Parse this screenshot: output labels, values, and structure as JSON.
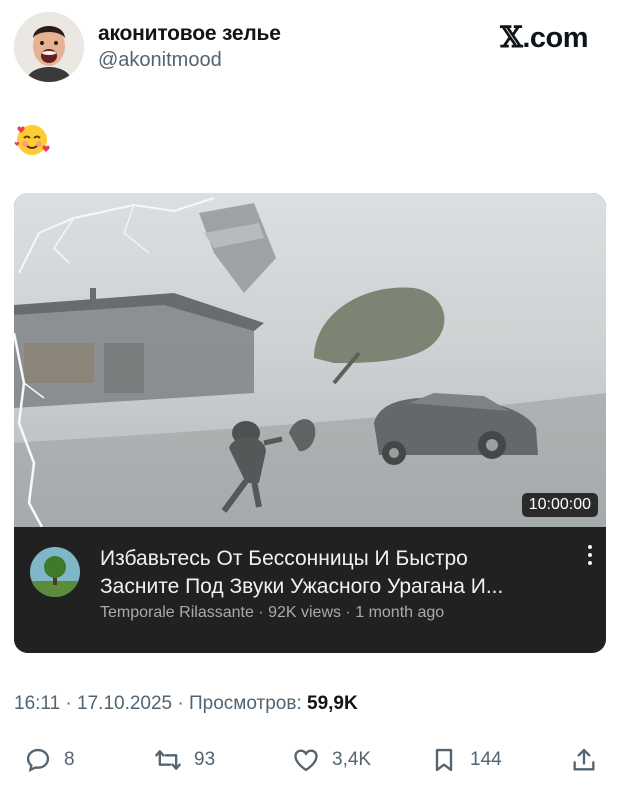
{
  "author": {
    "display_name": "аконитовое зелье",
    "handle": "@akonitmood"
  },
  "brand": {
    "x_glyph": "𝕏",
    "domain": ".com"
  },
  "post": {
    "emoji": "smiling-face-with-hearts"
  },
  "video": {
    "duration": "10:00:00",
    "title_line1": "Избавьтесь От Бессонницы И Быстро",
    "title_line2": "Засните Под Звуки Ужасного Урагана И...",
    "channel": "Temporale Rilassante",
    "views": "92K views",
    "age": "1 month ago",
    "separator": " · "
  },
  "meta": {
    "time": "16:11",
    "date": "17.10.2025",
    "views_label": "Просмотров:",
    "views_count": "59,9K",
    "dot": " · "
  },
  "actions": {
    "replies": "8",
    "reposts": "93",
    "likes": "3,4K",
    "bookmarks": "144"
  },
  "colors": {
    "text_primary": "#0f1419",
    "text_secondary": "#536471",
    "card_bg": "#212121"
  }
}
